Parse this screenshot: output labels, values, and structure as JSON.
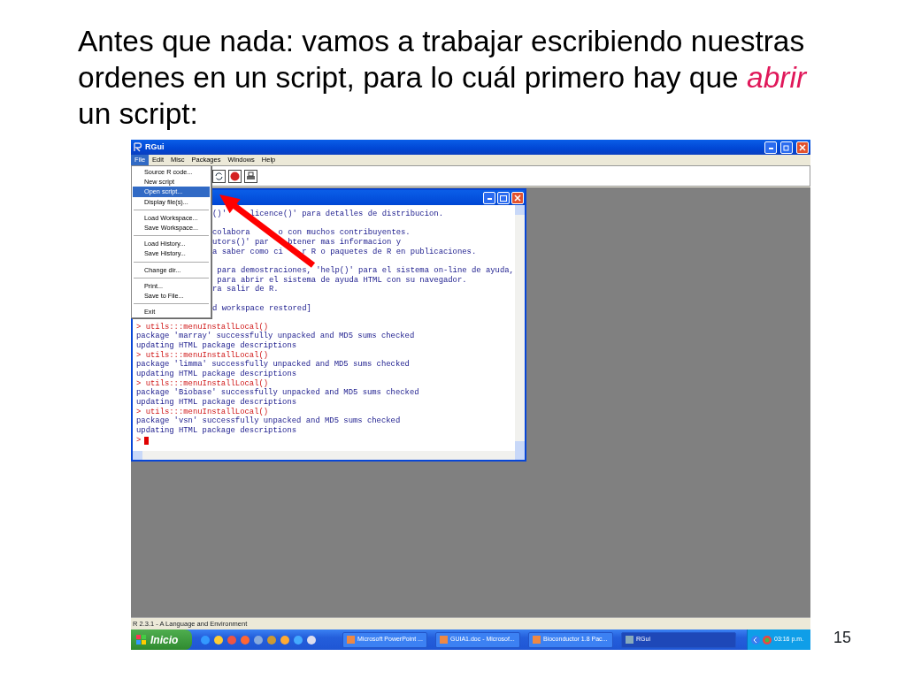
{
  "slide": {
    "title": "Antes que nada: vamos a trabajar escribiendo nuestras ordenes en un script, para lo cuál primero hay que *abrir* un script:",
    "page_number": "15"
  },
  "window": {
    "title": "RGui"
  },
  "menu_bar": [
    {
      "label": "File",
      "selected": true
    },
    {
      "label": "Edit",
      "selected": false
    },
    {
      "label": "Misc",
      "selected": false
    },
    {
      "label": "Packages",
      "selected": false
    },
    {
      "label": "Windows",
      "selected": false
    },
    {
      "label": "Help",
      "selected": false
    }
  ],
  "file_menu": [
    [
      {
        "label": "Source R code...",
        "selected": false
      },
      {
        "label": "New script",
        "selected": false
      },
      {
        "label": "Open script...",
        "selected": true
      },
      {
        "label": "Display file(s)...",
        "selected": false
      }
    ],
    [
      {
        "label": "Load Workspace...",
        "selected": false
      },
      {
        "label": "Save Workspace...",
        "selected": false
      }
    ],
    [
      {
        "label": "Load History...",
        "selected": false
      },
      {
        "label": "Save History...",
        "selected": false
      }
    ],
    [
      {
        "label": "Change dir...",
        "selected": false
      }
    ],
    [
      {
        "label": "Print...",
        "selected": false
      },
      {
        "label": "Save to File...",
        "selected": false
      }
    ],
    [
      {
        "label": "Exit",
        "selected": false
      }
    ]
  ],
  "console": {
    "partial_paragraphs": [
      [
        "()'     licence()' para detalles de distribucion."
      ],
      [
        "colabora      o con muchos contribuyentes.",
        "utors()' par    btener mas informacion y",
        "a saber como ci    r R o paquetes de R en publicaciones."
      ],
      [
        " para demostraciones, 'help()' para el sistema on-line de ayuda,",
        " para abrir el sistema de ayuda HTML con su navegador.",
        "ra salir de R."
      ],
      [
        "d workspace restored]"
      ]
    ],
    "lines": [
      {
        "kind": "input",
        "text": "> utils:::menuInstallLocal()"
      },
      {
        "kind": "output",
        "text": "package 'marray' successfully unpacked and MD5 sums checked"
      },
      {
        "kind": "output",
        "text": "updating HTML package descriptions"
      },
      {
        "kind": "input",
        "text": "> utils:::menuInstallLocal()"
      },
      {
        "kind": "output",
        "text": "package 'limma' successfully unpacked and MD5 sums checked"
      },
      {
        "kind": "output",
        "text": "updating HTML package descriptions"
      },
      {
        "kind": "input",
        "text": "> utils:::menuInstallLocal()"
      },
      {
        "kind": "output",
        "text": "package 'Biobase' successfully unpacked and MD5 sums checked"
      },
      {
        "kind": "output",
        "text": "updating HTML package descriptions"
      },
      {
        "kind": "input",
        "text": "> utils:::menuInstallLocal()"
      },
      {
        "kind": "output",
        "text": "package 'vsn' successfully unpacked and MD5 sums checked"
      },
      {
        "kind": "output",
        "text": "updating HTML package descriptions"
      },
      {
        "kind": "prompt",
        "text": ">"
      }
    ]
  },
  "status_bar": "R 2.3.1 - A Language and Environment",
  "taskbar": {
    "start": "Inicio",
    "tasks": [
      {
        "label": "Microsoft PowerPoint ...",
        "selected": false
      },
      {
        "label": "GUIA1.doc - Microsof...",
        "selected": false
      },
      {
        "label": "Bioconductor 1.8 Pac...",
        "selected": false
      },
      {
        "label": "RGui",
        "selected": true
      }
    ],
    "clock": "03:16 p.m."
  }
}
